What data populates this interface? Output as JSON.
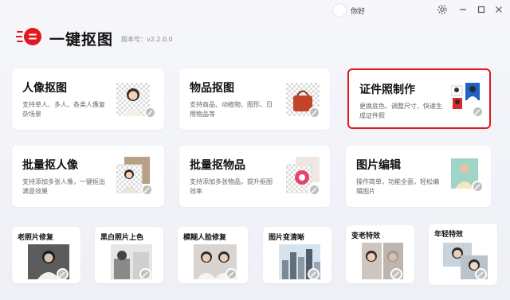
{
  "window": {
    "username": "你好",
    "controls": [
      "settings-icon",
      "minimize-icon",
      "maximize-icon",
      "close-icon"
    ]
  },
  "brand": {
    "title": "一键抠图",
    "version": "版本号：v2.2.0.0",
    "accent_color": "#e0191f"
  },
  "cards": {
    "portrait": {
      "title": "人像抠图",
      "desc": "支持单人、多人、各类人像复杂场景"
    },
    "object": {
      "title": "物品抠图",
      "desc": "支持商品、动植物、图形、日用物品等"
    },
    "idphoto": {
      "title": "证件照制作",
      "desc": "更换底色、调整尺寸、快速生成证件照",
      "selected": true
    },
    "batch_portrait": {
      "title": "批量抠人像",
      "desc": "支持添加多张人像，一键抠出满意效果"
    },
    "batch_object": {
      "title": "批量抠物品",
      "desc": "支持添加多张物品，提升抠图效率"
    },
    "image_edit": {
      "title": "图片编辑",
      "desc": "操作简单，功能全面，轻松编辑图片"
    }
  },
  "small_cards": {
    "old_photo": {
      "title": "老照片修复"
    },
    "colorize": {
      "title": "黑白照片上色"
    },
    "blur_face": {
      "title": "模糊人脸修复"
    },
    "enhance": {
      "title": "图片变清晰"
    },
    "aging": {
      "title": "变老特效"
    },
    "young": {
      "title": "年轻特效"
    }
  }
}
